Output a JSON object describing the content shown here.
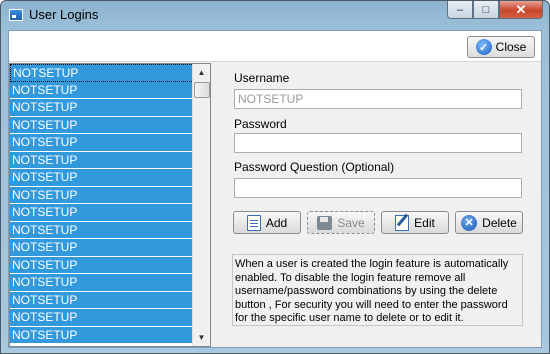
{
  "window": {
    "title": "User Logins",
    "caption_minimize": "‒",
    "caption_maximize": "□",
    "caption_close": "✕"
  },
  "toolbar": {
    "close_label": "Close"
  },
  "users": {
    "items": [
      "NOTSETUP",
      "NOTSETUP",
      "NOTSETUP",
      "NOTSETUP",
      "NOTSETUP",
      "NOTSETUP",
      "NOTSETUP",
      "NOTSETUP",
      "NOTSETUP",
      "NOTSETUP",
      "NOTSETUP",
      "NOTSETUP",
      "NOTSETUP",
      "NOTSETUP",
      "NOTSETUP",
      "NOTSETUP"
    ],
    "selected_index": 0
  },
  "form": {
    "username_label": "Username",
    "username_value": "NOTSETUP",
    "password_label": "Password",
    "password_value": "",
    "question_label": "Password Question (Optional)",
    "question_value": ""
  },
  "actions": {
    "add_label": "Add",
    "save_label": "Save",
    "edit_label": "Edit",
    "delete_label": "Delete"
  },
  "info_text": "When a user is created the login feature is automatically enabled. To disable the login feature remove all username/password combinations by using the delete button , For security you will need to enter the password for the specific user name to delete or to edit it.",
  "colors": {
    "list_highlight": "#3399dd",
    "title_bar": "#9cc0d9"
  }
}
